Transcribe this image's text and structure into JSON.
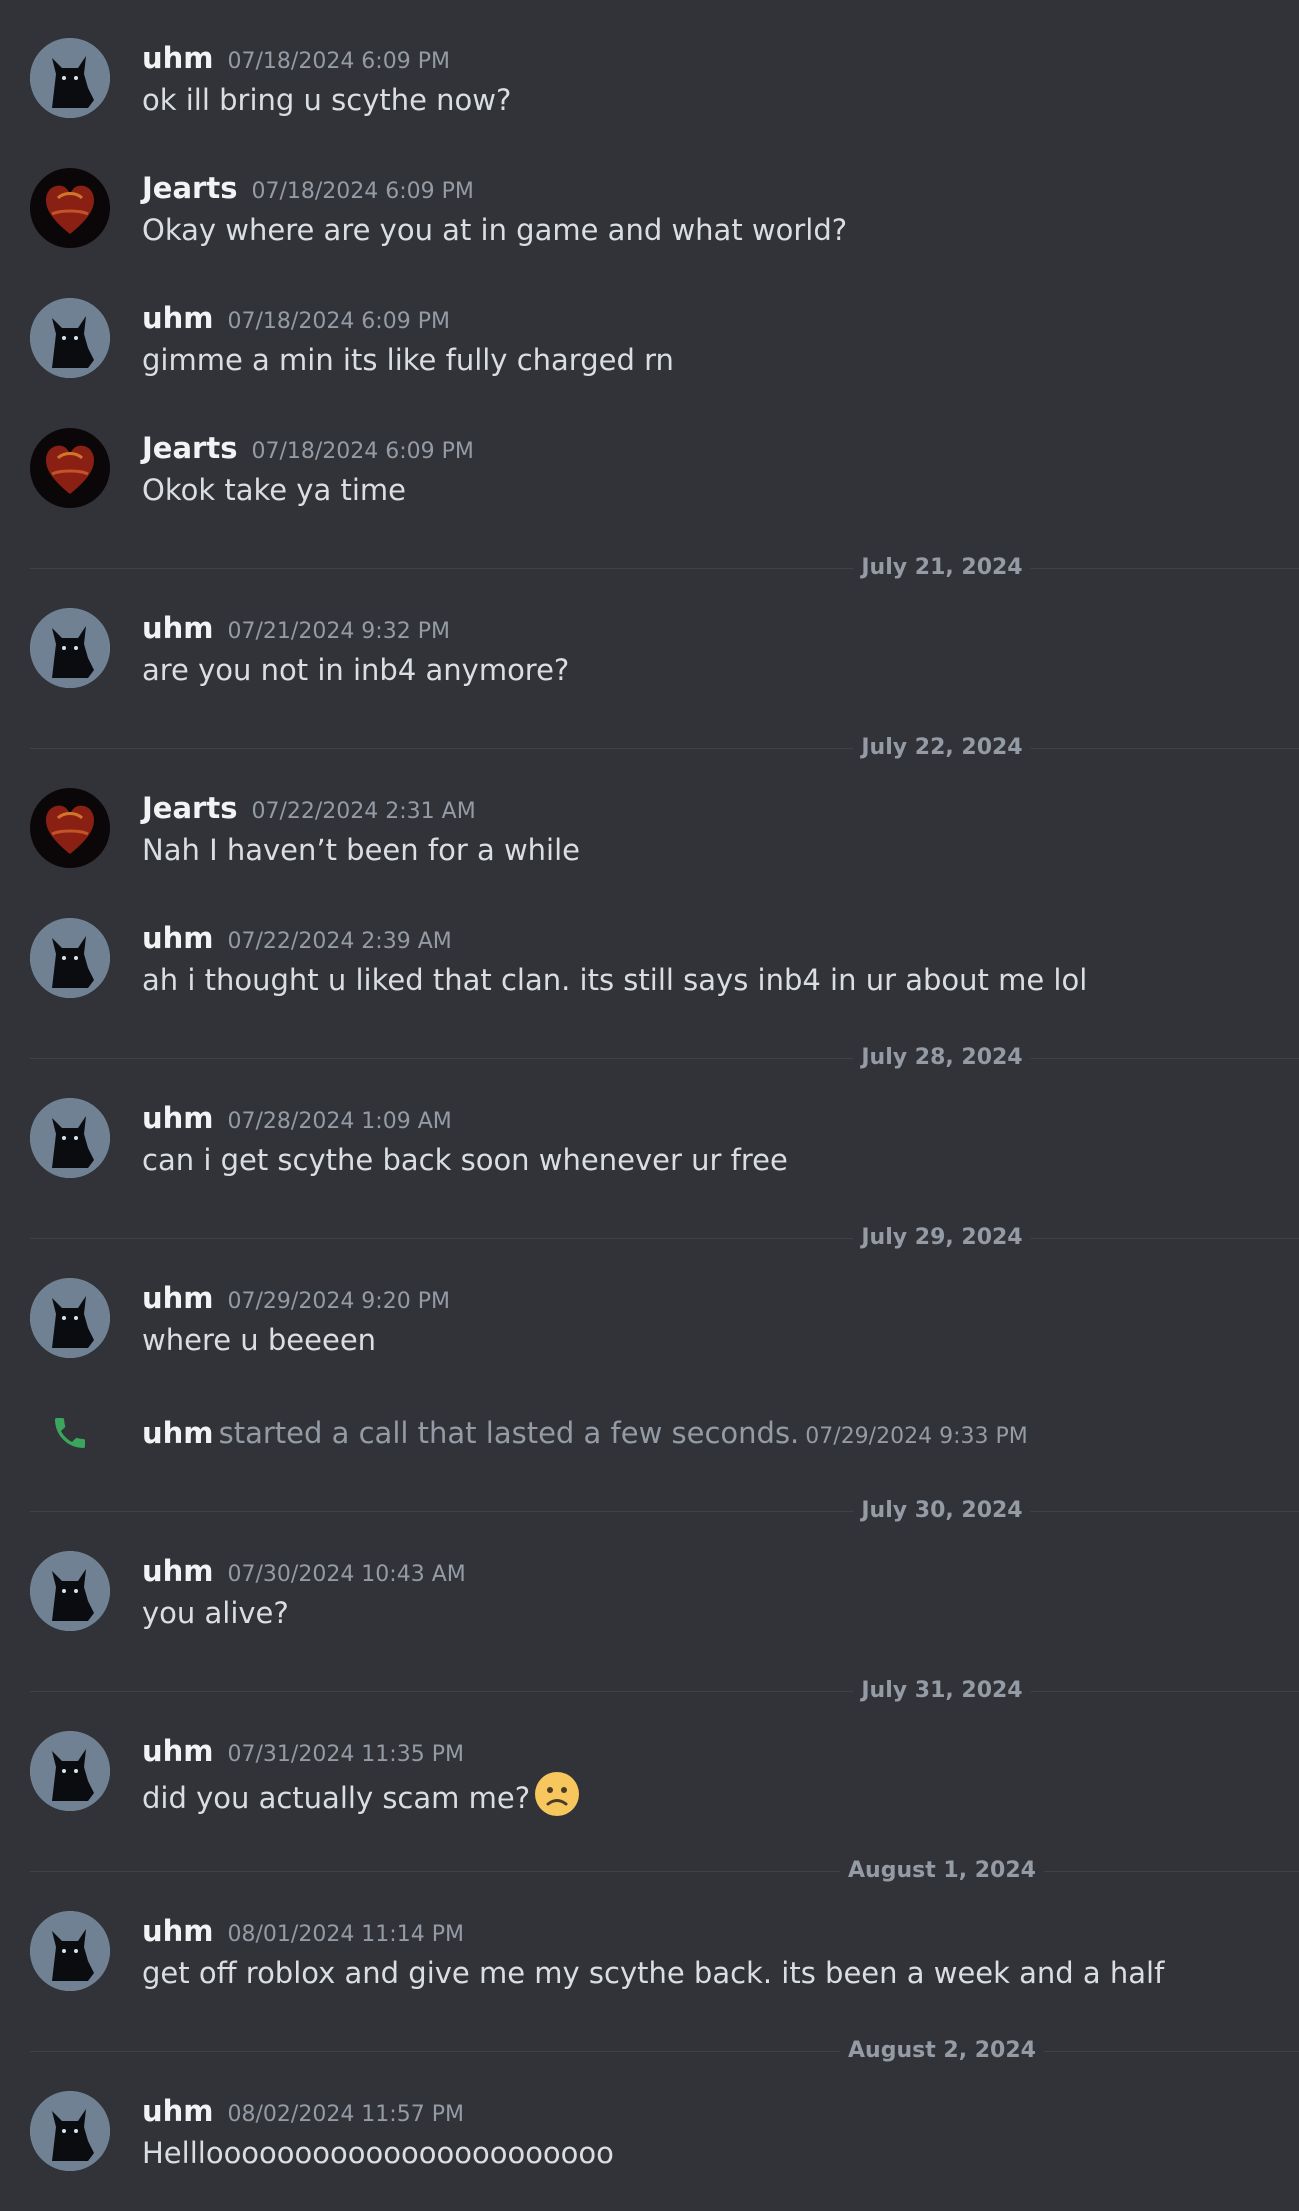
{
  "messages": [
    {
      "author": "uhm",
      "timestamp": "07/18/2024 6:09 PM",
      "text": "ok ill bring u scythe now?",
      "avatar_icon": "black-cat-icon"
    },
    {
      "author": "Jearts",
      "timestamp": "07/18/2024 6:09 PM",
      "text": "Okay where are you at in game and what world?",
      "avatar_icon": "heart-logo-icon"
    },
    {
      "author": "uhm",
      "timestamp": "07/18/2024 6:09 PM",
      "text": "gimme a min its like fully charged rn",
      "avatar_icon": "black-cat-icon"
    },
    {
      "author": "Jearts",
      "timestamp": "07/18/2024 6:09 PM",
      "text": "Okok take ya time",
      "avatar_icon": "heart-logo-icon"
    },
    {
      "divider": "July 21, 2024"
    },
    {
      "author": "uhm",
      "timestamp": "07/21/2024 9:32 PM",
      "text": "are you not in inb4 anymore?",
      "avatar_icon": "black-cat-icon"
    },
    {
      "divider": "July 22, 2024"
    },
    {
      "author": "Jearts",
      "timestamp": "07/22/2024 2:31 AM",
      "text": "Nah I haven’t been for a while",
      "avatar_icon": "heart-logo-icon"
    },
    {
      "author": "uhm",
      "timestamp": "07/22/2024 2:39 AM",
      "text": "ah i thought u liked that clan. its still says inb4 in ur about me lol",
      "avatar_icon": "black-cat-icon"
    },
    {
      "divider": "July 28, 2024"
    },
    {
      "author": "uhm",
      "timestamp": "07/28/2024 1:09 AM",
      "text": "can i get scythe back soon whenever ur free",
      "avatar_icon": "black-cat-icon"
    },
    {
      "divider": "July 29, 2024"
    },
    {
      "author": "uhm",
      "timestamp": "07/29/2024 9:20 PM",
      "text": "where u beeeen",
      "avatar_icon": "black-cat-icon"
    },
    {
      "call": {
        "author": "uhm",
        "text": "started a call that lasted a few seconds.",
        "timestamp": "07/29/2024 9:33 PM",
        "icon": "phone-icon",
        "color": "#3ba55d"
      }
    },
    {
      "divider": "July 30, 2024"
    },
    {
      "author": "uhm",
      "timestamp": "07/30/2024 10:43 AM",
      "text": "you alive?",
      "avatar_icon": "black-cat-icon"
    },
    {
      "divider": "July 31, 2024"
    },
    {
      "author": "uhm",
      "timestamp": "07/31/2024 11:35 PM",
      "text": "did you actually scam me?",
      "avatar_icon": "black-cat-icon",
      "emoji": "frowning-face-emoji"
    },
    {
      "divider": "August 1, 2024"
    },
    {
      "author": "uhm",
      "timestamp": "08/01/2024 11:14 PM",
      "text": "get off roblox and give me my scythe back. its been a week and a half",
      "avatar_icon": "black-cat-icon"
    },
    {
      "divider": "August 2, 2024"
    },
    {
      "author": "uhm",
      "timestamp": "08/02/2024 11:57 PM",
      "text": "Helllooooooooooooooooooooooo",
      "avatar_icon": "black-cat-icon"
    }
  ],
  "colors": {
    "background": "#313338",
    "username": "#f2f3f5",
    "text": "#dbdee1",
    "muted": "#949ba4",
    "divider_line": "#3f4147",
    "call_green": "#3ba55d"
  }
}
